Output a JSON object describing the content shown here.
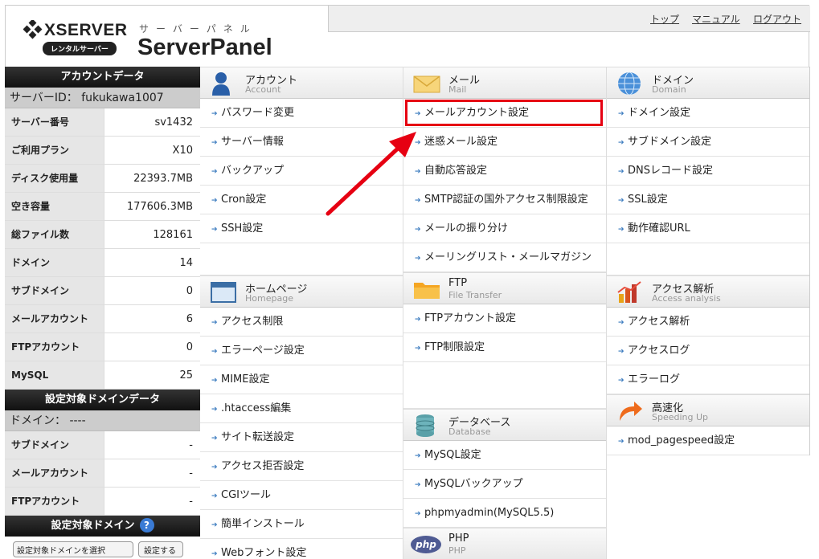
{
  "header": {
    "logo_text": "XSERVER",
    "logo_badge": "レンタルサーバー",
    "kana": "サーバーパネル",
    "title": "ServerPanel",
    "nav": [
      "トップ",
      "マニュアル",
      "ログアウト"
    ]
  },
  "account_data": {
    "heading": "アカウントデータ",
    "server_id": "サーバーID： fukukawa1007",
    "rows": [
      {
        "label": "サーバー番号",
        "value": "sv1432"
      },
      {
        "label": "ご利用プラン",
        "value": "X10"
      },
      {
        "label": "ディスク使用量",
        "value": "22393.7MB"
      },
      {
        "label": "空き容量",
        "value": "177606.3MB"
      },
      {
        "label": "総ファイル数",
        "value": "128161"
      },
      {
        "label": "ドメイン",
        "value": "14"
      },
      {
        "label": "サブドメイン",
        "value": "0"
      },
      {
        "label": "メールアカウント",
        "value": "6"
      },
      {
        "label": "FTPアカウント",
        "value": "0"
      },
      {
        "label": "MySQL",
        "value": "25"
      }
    ]
  },
  "domain_data": {
    "heading": "設定対象ドメインデータ",
    "domain_line": "ドメイン： ----",
    "rows": [
      {
        "label": "サブドメイン",
        "value": "-"
      },
      {
        "label": "メールアカウント",
        "value": "-"
      },
      {
        "label": "FTPアカウント",
        "value": "-"
      }
    ]
  },
  "target_domain": {
    "heading": "設定対象ドメイン",
    "help": "?",
    "select_label": "設定対象ドメインを選択",
    "button_label": "設定する"
  },
  "sections": {
    "account": {
      "title": "アカウント",
      "sub": "Account",
      "items": [
        "パスワード変更",
        "サーバー情報",
        "バックアップ",
        "Cron設定",
        "SSH設定"
      ]
    },
    "homepage": {
      "title": "ホームページ",
      "sub": "Homepage",
      "items": [
        "アクセス制限",
        "エラーページ設定",
        "MIME設定",
        ".htaccess編集",
        "サイト転送設定",
        "アクセス拒否設定",
        "CGIツール",
        "簡単インストール",
        "Webフォント設定"
      ]
    },
    "mail": {
      "title": "メール",
      "sub": "Mail",
      "items": [
        "メールアカウント設定",
        "迷惑メール設定",
        "自動応答設定",
        "SMTP認証の国外アクセス制限設定",
        "メールの振り分け",
        "メーリングリスト・メールマガジン"
      ]
    },
    "ftp": {
      "title": "FTP",
      "sub": "File Transfer",
      "items": [
        "FTPアカウント設定",
        "FTP制限設定"
      ]
    },
    "database": {
      "title": "データベース",
      "sub": "Database",
      "items": [
        "MySQL設定",
        "MySQLバックアップ",
        "phpmyadmin(MySQL5.5)"
      ]
    },
    "php": {
      "title": "PHP",
      "sub": "PHP",
      "icon_text": "php"
    },
    "domain": {
      "title": "ドメイン",
      "sub": "Domain",
      "items": [
        "ドメイン設定",
        "サブドメイン設定",
        "DNSレコード設定",
        "SSL設定",
        "動作確認URL"
      ]
    },
    "access": {
      "title": "アクセス解析",
      "sub": "Access analysis",
      "items": [
        "アクセス解析",
        "アクセスログ",
        "エラーログ"
      ]
    },
    "speed": {
      "title": "高速化",
      "sub": "Speeding Up",
      "items": [
        "mod_pagespeed設定"
      ]
    }
  }
}
